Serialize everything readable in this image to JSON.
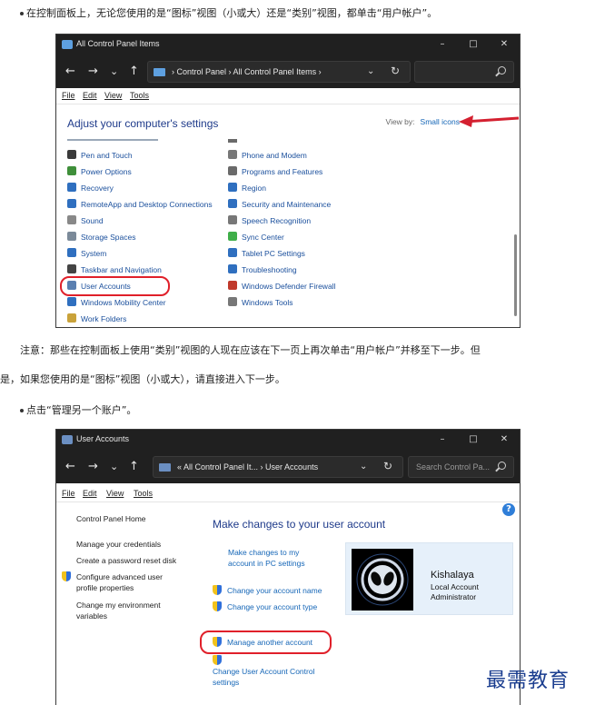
{
  "article": {
    "bullet1": "在控制面板上，无论您使用的是“图标”视图（小或大）还是“类别”视图，都单击“用户帐户”。",
    "note_line1": "注意：那些在控制面板上使用“类别”视图的人现在应该在下一页上再次单击“用户帐户”并移至下一步。但",
    "note_line2": "是，如果您使用的是“图标”视图（小或大），请直接进入下一步。",
    "bullet2": "点击“管理另一个账户”。"
  },
  "window1": {
    "title": "All Control Panel Items",
    "controls": {
      "minimize": "–",
      "maximize": "□",
      "close": "✕"
    },
    "nav": {
      "back": "←",
      "forward": "→",
      "recent": "⌄",
      "up": "↑",
      "refresh": "↻",
      "dropdown": "⌄"
    },
    "breadcrumb": "›  Control Panel  ›  All Control Panel Items  ›",
    "search_placeholder": "",
    "menu": [
      "File",
      "Edit",
      "View",
      "Tools"
    ],
    "header": "Adjust your computer's settings",
    "view_by_label": "View by:",
    "view_by_value": "Small icons",
    "items_left": [
      {
        "label": "Pen and Touch",
        "icon": "pen-icon",
        "color": "#3a3a3a"
      },
      {
        "label": "Power Options",
        "icon": "power-icon",
        "color": "#3f8f3a"
      },
      {
        "label": "Recovery",
        "icon": "recovery-icon",
        "color": "#2f6fbf"
      },
      {
        "label": "RemoteApp and Desktop Connections",
        "icon": "remoteapp-icon",
        "color": "#2f6fbf"
      },
      {
        "label": "Sound",
        "icon": "sound-icon",
        "color": "#888888"
      },
      {
        "label": "Storage Spaces",
        "icon": "storage-icon",
        "color": "#7b8a99"
      },
      {
        "label": "System",
        "icon": "system-icon",
        "color": "#2f6fbf"
      },
      {
        "label": "Taskbar and Navigation",
        "icon": "taskbar-icon",
        "color": "#444444"
      },
      {
        "label": "User Accounts",
        "icon": "user-accounts-icon",
        "color": "#5a7fb0"
      },
      {
        "label": "Windows Mobility Center",
        "icon": "mobility-icon",
        "color": "#2f6fbf"
      },
      {
        "label": "Work Folders",
        "icon": "work-folders-icon",
        "color": "#c9a23a"
      }
    ],
    "items_right": [
      {
        "label": "Phone and Modem",
        "icon": "phone-icon",
        "color": "#777777"
      },
      {
        "label": "Programs and Features",
        "icon": "programs-icon",
        "color": "#6a6a6a"
      },
      {
        "label": "Region",
        "icon": "region-icon",
        "color": "#2f6fbf"
      },
      {
        "label": "Security and Maintenance",
        "icon": "flag-icon",
        "color": "#2f6fbf"
      },
      {
        "label": "Speech Recognition",
        "icon": "microphone-icon",
        "color": "#777777"
      },
      {
        "label": "Sync Center",
        "icon": "sync-icon",
        "color": "#3fae49"
      },
      {
        "label": "Tablet PC Settings",
        "icon": "tablet-icon",
        "color": "#2f6fbf"
      },
      {
        "label": "Troubleshooting",
        "icon": "troubleshoot-icon",
        "color": "#2f6fbf"
      },
      {
        "label": "Windows Defender Firewall",
        "icon": "firewall-icon",
        "color": "#c0392b"
      },
      {
        "label": "Windows Tools",
        "icon": "tools-icon",
        "color": "#777777"
      }
    ]
  },
  "window2": {
    "title": "User Accounts",
    "breadcrumb": "«  All Control Panel It...  ›  User Accounts",
    "search_placeholder": "Search Control Pa...",
    "menu": [
      "File",
      "Edit",
      "View",
      "Tools"
    ],
    "left_nav": {
      "home": "Control Panel Home",
      "credentials": "Manage your credentials",
      "reset_disk": "Create a password reset disk",
      "advanced_1": "Configure advanced user",
      "advanced_2": "profile properties",
      "env_1": "Change my environment",
      "env_2": "variables"
    },
    "main_title": "Make changes to your user account",
    "links": {
      "pc_settings_1": "Make changes to my",
      "pc_settings_2": "account in PC settings",
      "change_name": "Change your account name",
      "change_type": "Change your account type",
      "manage_another": "Manage another account",
      "uac_1": "Change User Account Control",
      "uac_2": "settings"
    },
    "user": {
      "name": "Kishalaya",
      "line1": "Local Account",
      "line2": "Administrator"
    },
    "help": "?"
  },
  "watermark": "最需教育"
}
